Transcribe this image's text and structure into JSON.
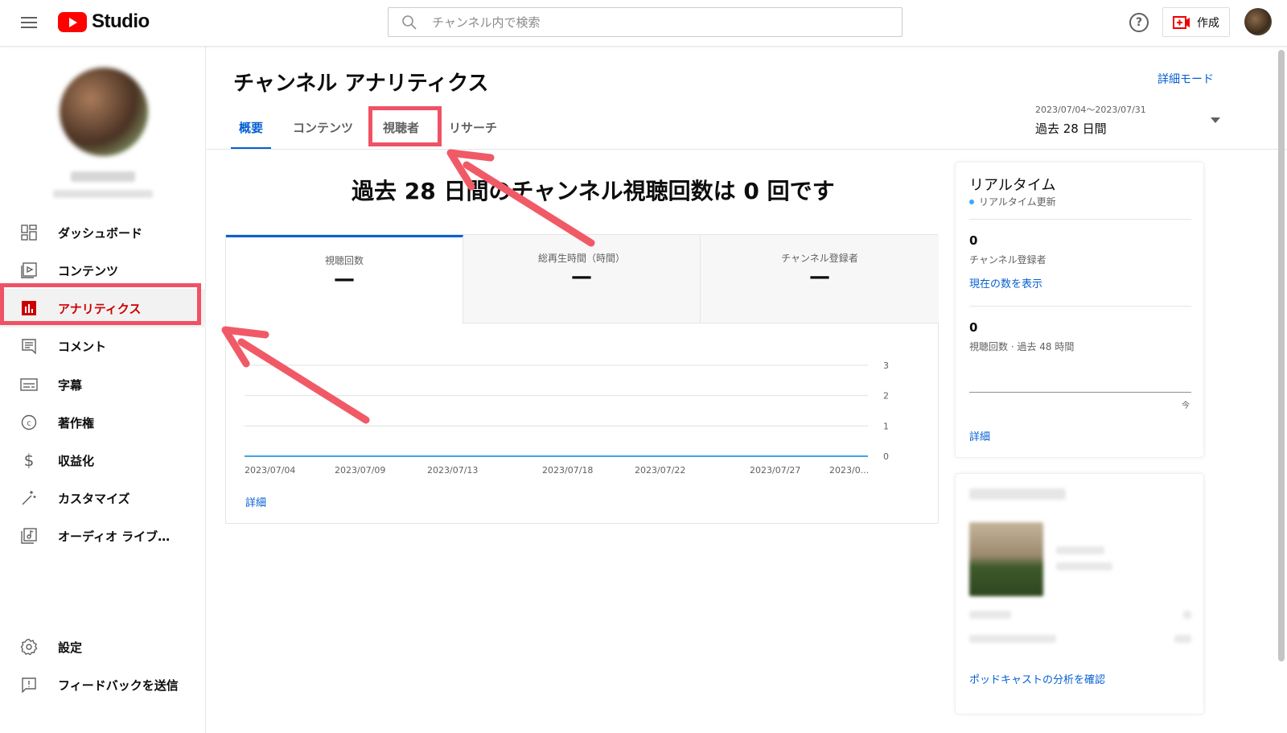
{
  "header": {
    "logo_text": "Studio",
    "search_placeholder": "チャンネル内で検索",
    "help_label": "?",
    "create_label": "作成"
  },
  "sidebar": {
    "items": [
      {
        "label": "ダッシュボード",
        "icon": "dashboard-icon"
      },
      {
        "label": "コンテンツ",
        "icon": "content-icon"
      },
      {
        "label": "アナリティクス",
        "icon": "analytics-icon",
        "active": true
      },
      {
        "label": "コメント",
        "icon": "comment-icon"
      },
      {
        "label": "字幕",
        "icon": "subtitles-icon"
      },
      {
        "label": "著作権",
        "icon": "copyright-icon"
      },
      {
        "label": "収益化",
        "icon": "dollar-icon"
      },
      {
        "label": "カスタマイズ",
        "icon": "magic-wand-icon"
      },
      {
        "label": "オーディオ ライブ…",
        "icon": "audio-library-icon"
      }
    ],
    "bottom_items": [
      {
        "label": "設定",
        "icon": "gear-icon"
      },
      {
        "label": "フィードバックを送信",
        "icon": "feedback-icon"
      }
    ]
  },
  "main": {
    "title": "チャンネル アナリティクス",
    "detail_mode": "詳細モード",
    "tabs": [
      {
        "label": "概要",
        "active": true
      },
      {
        "label": "コンテンツ"
      },
      {
        "label": "視聴者",
        "highlighted": true
      },
      {
        "label": "リサーチ"
      }
    ],
    "date_range": {
      "dates": "2023/07/04〜2023/07/31",
      "label": "過去 28 日間"
    },
    "headline": "過去 28 日間のチャンネル視聴回数は 0 回です",
    "metrics": [
      {
        "label": "視聴回数",
        "value": "—"
      },
      {
        "label": "総再生時間（時間）",
        "value": "—"
      },
      {
        "label": "チャンネル登録者",
        "value": "—"
      }
    ],
    "detail_link": "詳細"
  },
  "chart_data": {
    "type": "line",
    "categories": [
      "2023/07/04",
      "2023/07/09",
      "2023/07/13",
      "2023/07/18",
      "2023/07/22",
      "2023/07/27",
      "2023/0..."
    ],
    "series": [
      {
        "values": [
          0,
          0,
          0,
          0,
          0,
          0,
          0
        ]
      }
    ],
    "ylim": [
      0,
      3
    ],
    "yticks": [
      "3",
      "2",
      "1",
      "0"
    ],
    "grid": true,
    "color": "#41a6e6"
  },
  "realtime": {
    "title": "リアルタイム",
    "subtitle": "リアルタイム更新",
    "subscribers_value": "0",
    "subscribers_label": "チャンネル登録者",
    "show_current_link": "現在の数を表示",
    "views_value": "0",
    "views_label": "視聴回数 · 過去 48 時間",
    "now_label": "今",
    "detail_link": "詳細"
  },
  "podcast": {
    "link": "ポッドキャストの分析を確認"
  },
  "colors": {
    "accent_blue": "#065fd4",
    "active_red": "#cc0000",
    "highlight_red": "#ef5265",
    "chart_line": "#41a6e6"
  }
}
